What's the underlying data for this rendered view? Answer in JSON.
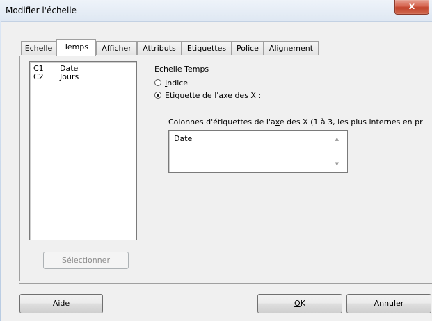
{
  "window": {
    "title": "Modifier l'échelle",
    "close_glyph": "x"
  },
  "tabs": [
    {
      "label": "Echelle"
    },
    {
      "label": "Temps",
      "active": true
    },
    {
      "label": "Afficher"
    },
    {
      "label": "Attributs"
    },
    {
      "label": "Etiquettes"
    },
    {
      "label": "Police"
    },
    {
      "label": "Alignement"
    }
  ],
  "variables": [
    {
      "code": "C1",
      "name": "Date"
    },
    {
      "code": "C2",
      "name": "Jours"
    }
  ],
  "select_button": "Sélectionner",
  "time_scale": {
    "label": "Echelle Temps",
    "option_index": {
      "underlined": "I",
      "rest": "ndice",
      "checked": false
    },
    "option_xlabel": {
      "first": "E",
      "underlined": "t",
      "rest": "iquette de l'axe des X :",
      "checked": true
    },
    "columns_label": {
      "before": "Colonnes d'étiquettes de l'a",
      "underlined": "x",
      "after": "e des X (1 à 3, les plus internes en pr"
    },
    "columns_value": "Date"
  },
  "footer": {
    "help": "Aide",
    "ok_underlined": "O",
    "ok_rest": "K",
    "cancel": "Annuler"
  },
  "icons": {
    "scroll_up": "▲",
    "scroll_down": "▼"
  }
}
